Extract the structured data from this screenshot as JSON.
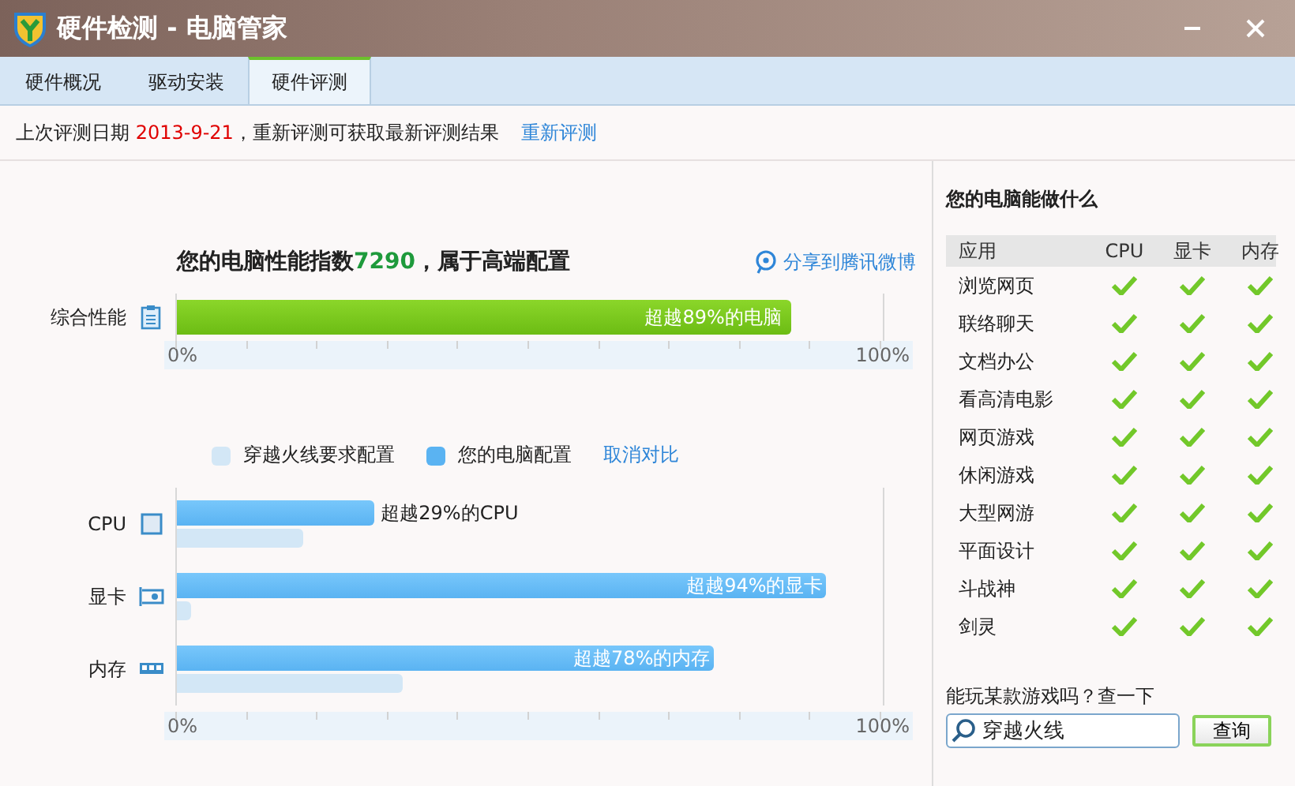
{
  "window": {
    "title": "硬件检测 - 电脑管家"
  },
  "tabs": [
    {
      "label": "硬件概况",
      "selected": false
    },
    {
      "label": "驱动安装",
      "selected": false
    },
    {
      "label": "硬件评测",
      "selected": true
    }
  ],
  "info": {
    "prefix": "上次评测日期",
    "date": "2013-9-21",
    "suffix": "，重新评测可获取最新评测结果",
    "link": "重新评测"
  },
  "score": {
    "prefix": "您的电脑性能指数",
    "value": "7290",
    "suffix": "，属于高端配置",
    "share": "分享到腾讯微博"
  },
  "overall": {
    "label": "综合性能",
    "level": 0.87,
    "text": "超越89%的电脑"
  },
  "axis_top": {
    "min": "0%",
    "max": "100%"
  },
  "legend": {
    "required": "穿越火线要求配置",
    "yours": "您的电脑配置",
    "cancel": "取消对比"
  },
  "components": [
    {
      "kind": "cpu",
      "label": "CPU",
      "level": 0.28,
      "required": {
        "level": 0.18
      },
      "text": "超越29%的CPU"
    },
    {
      "kind": "gpu",
      "label": "显卡",
      "level": 0.92,
      "required": {
        "level": 0.02
      },
      "text": "超越94%的显卡"
    },
    {
      "kind": "memory",
      "label": "内存",
      "level": 0.76,
      "required": {
        "level": 0.32
      },
      "text": "超越78%的内存"
    }
  ],
  "axis_bottom": {
    "min": "0%",
    "max": "100%"
  },
  "capabilities": {
    "title": "您的电脑能做什么",
    "columns": [
      "应用",
      "CPU",
      "显卡",
      "内存"
    ],
    "rows": [
      {
        "name": "浏览网页",
        "checks": [
          true,
          true,
          true
        ]
      },
      {
        "name": "联络聊天",
        "checks": [
          true,
          true,
          true
        ]
      },
      {
        "name": "文档办公",
        "checks": [
          true,
          true,
          true
        ]
      },
      {
        "name": "看高清电影",
        "checks": [
          true,
          true,
          true
        ]
      },
      {
        "name": "网页游戏",
        "checks": [
          true,
          true,
          true
        ]
      },
      {
        "name": "休闲游戏",
        "checks": [
          true,
          true,
          true
        ]
      },
      {
        "name": "大型网游",
        "checks": [
          true,
          true,
          true
        ]
      },
      {
        "name": "平面设计",
        "checks": [
          true,
          true,
          true
        ]
      },
      {
        "name": "斗战神",
        "checks": [
          true,
          true,
          true
        ]
      },
      {
        "name": "剑灵",
        "checks": [
          true,
          true,
          true
        ]
      }
    ]
  },
  "game_search": {
    "question": "能玩某款游戏吗？查一下",
    "value": "穿越火线",
    "button": "查询"
  }
}
